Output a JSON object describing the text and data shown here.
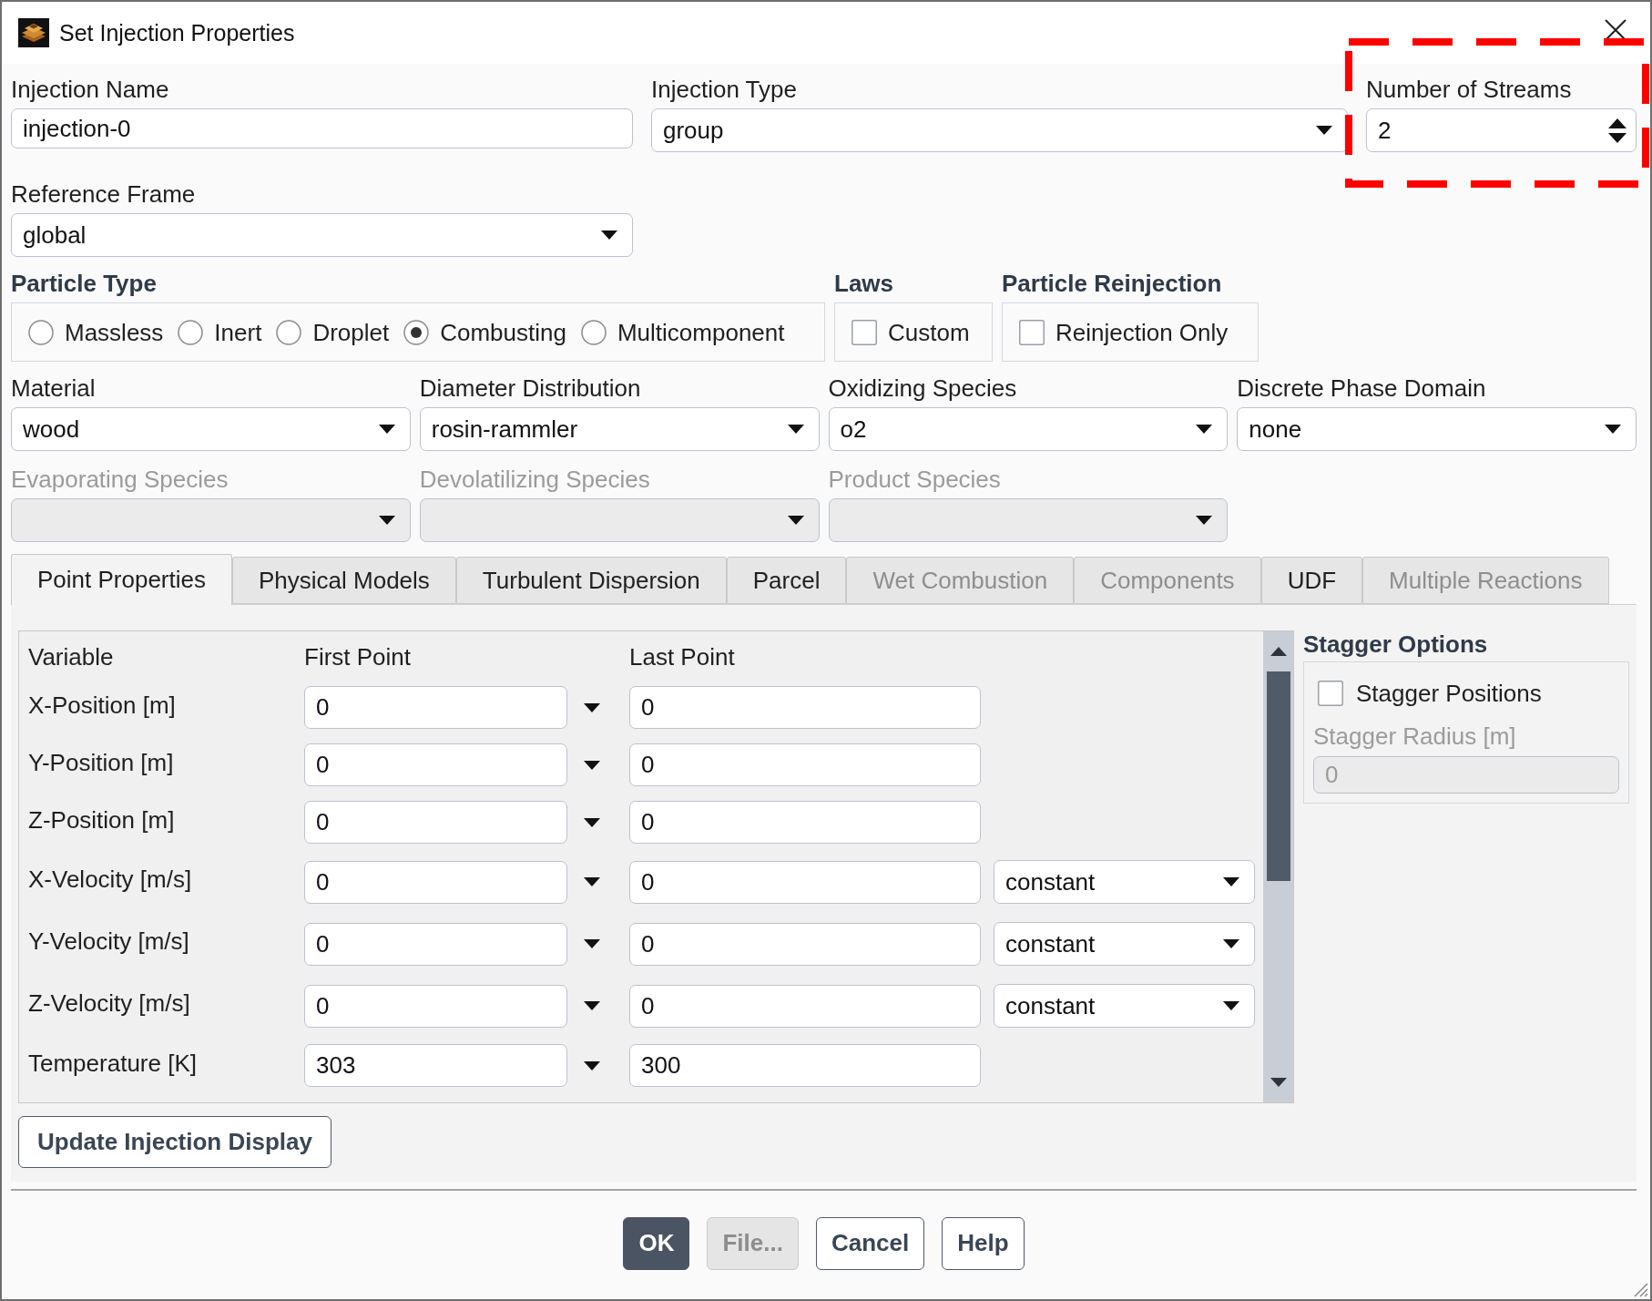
{
  "window": {
    "title": "Set Injection Properties"
  },
  "injection_name": {
    "label": "Injection Name",
    "value": "injection-0"
  },
  "injection_type": {
    "label": "Injection Type",
    "value": "group"
  },
  "number_of_streams": {
    "label": "Number of Streams",
    "value": "2",
    "highlighted": true
  },
  "reference_frame": {
    "label": "Reference Frame",
    "value": "global"
  },
  "particle_type": {
    "heading": "Particle Type",
    "options": [
      {
        "label": "Massless",
        "selected": false
      },
      {
        "label": "Inert",
        "selected": false
      },
      {
        "label": "Droplet",
        "selected": false
      },
      {
        "label": "Combusting",
        "selected": true
      },
      {
        "label": "Multicomponent",
        "selected": false
      }
    ]
  },
  "laws": {
    "heading": "Laws",
    "checkbox": {
      "label": "Custom",
      "checked": false
    }
  },
  "particle_reinjection": {
    "heading": "Particle Reinjection",
    "checkbox": {
      "label": "Reinjection Only",
      "checked": false
    }
  },
  "dropdown_rows": [
    {
      "fields": [
        {
          "label": "Material",
          "value": "wood",
          "disabled": false
        },
        {
          "label": "Diameter Distribution",
          "value": "rosin-rammler",
          "disabled": false
        },
        {
          "label": "Oxidizing Species",
          "value": "o2",
          "disabled": false
        },
        {
          "label": "Discrete Phase Domain",
          "value": "none",
          "disabled": false
        }
      ]
    },
    {
      "fields": [
        {
          "label": "Evaporating Species",
          "disabled": true
        },
        {
          "label": "Devolatilizing Species",
          "disabled": true
        },
        {
          "label": "Product Species",
          "disabled": true
        }
      ]
    }
  ],
  "tabs": [
    {
      "label": "Point Properties",
      "selected": true,
      "disabled": false
    },
    {
      "label": "Physical Models",
      "selected": false,
      "disabled": false
    },
    {
      "label": "Turbulent Dispersion",
      "selected": false,
      "disabled": false
    },
    {
      "label": "Parcel",
      "selected": false,
      "disabled": false
    },
    {
      "label": "Wet Combustion",
      "selected": false,
      "disabled": true
    },
    {
      "label": "Components",
      "selected": false,
      "disabled": true
    },
    {
      "label": "UDF",
      "selected": false,
      "disabled": false
    },
    {
      "label": "Multiple Reactions",
      "selected": false,
      "disabled": true
    }
  ],
  "point_table": {
    "columns": [
      "Variable",
      "First Point",
      "Last Point"
    ],
    "rows": [
      {
        "variable": "X-Position [m]",
        "first_point": "0",
        "last_point": "0"
      },
      {
        "variable": "Y-Position [m]",
        "first_point": "0",
        "last_point": "0"
      },
      {
        "variable": "Z-Position [m]",
        "first_point": "0",
        "last_point": "0"
      },
      {
        "variable": "X-Velocity [m/s]",
        "first_point": "0",
        "last_point": "0",
        "option": "constant"
      },
      {
        "variable": "Y-Velocity [m/s]",
        "first_point": "0",
        "last_point": "0",
        "option": "constant"
      },
      {
        "variable": "Z-Velocity [m/s]",
        "first_point": "0",
        "last_point": "0",
        "option": "constant"
      },
      {
        "variable": "Temperature [K]",
        "first_point": "303",
        "last_point": "300"
      }
    ]
  },
  "stagger_options": {
    "heading": "Stagger Options",
    "positions": {
      "label": "Stagger Positions",
      "checked": false
    },
    "radius": {
      "label": "Stagger Radius [m]",
      "value": "0",
      "disabled": true
    }
  },
  "update_button": {
    "label": "Update Injection Display"
  },
  "buttons": [
    {
      "label": "OK",
      "kind": "primary"
    },
    {
      "label": "File...",
      "kind": "disabled"
    },
    {
      "label": "Cancel",
      "kind": "normal"
    },
    {
      "label": "Help",
      "kind": "normal"
    }
  ]
}
